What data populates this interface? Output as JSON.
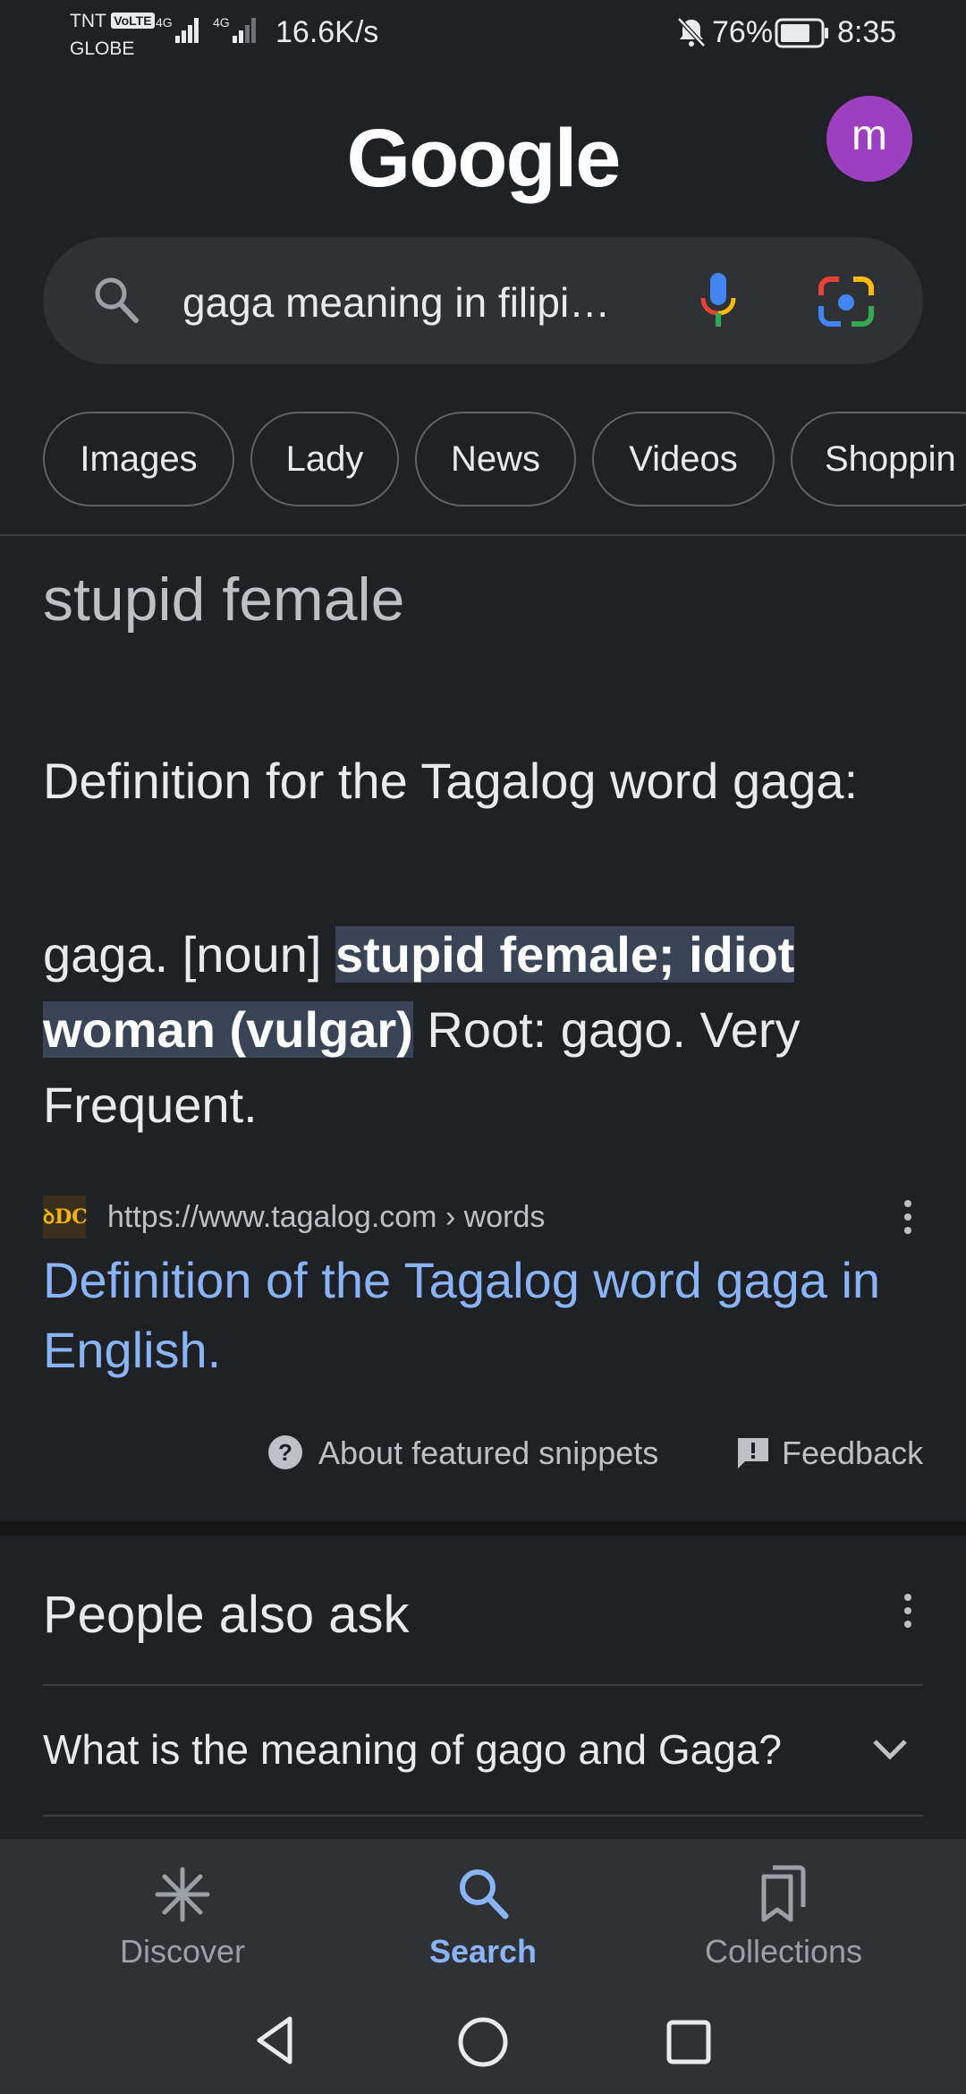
{
  "status_bar": {
    "carrier_line1": "TNT",
    "volte_badge": "VoLTE",
    "carrier_line2": "GLOBE",
    "network_type_1": "4G",
    "network_type_2": "4G",
    "net_speed": "16.6K/s",
    "battery": "76%",
    "battery_level": 0.76,
    "time": "8:35"
  },
  "header": {
    "logo": "Google",
    "avatar_letter": "m",
    "avatar_color": "#9c3fc0"
  },
  "search": {
    "query": "gaga meaning in filipi…"
  },
  "chips": [
    "Images",
    "Lady",
    "News",
    "Videos",
    "Shoppin"
  ],
  "snippet": {
    "answer": "stupid female",
    "definition_title": "Definition for the Tagalog word gaga:",
    "def_prefix": "gaga. [noun] ",
    "def_highlight": "stupid female; idiot woman (vulgar)",
    "def_suffix": " Root: gago. Very Frequent.",
    "favicon_text": "ꝺDC",
    "source_url": "https://www.tagalog.com › words",
    "result_title": "Definition of the Tagalog word gaga in English.",
    "about_label": "About featured snippets",
    "feedback_label": "Feedback"
  },
  "people_also_ask": {
    "title": "People also ask",
    "questions": [
      "What is the meaning of gago and Gaga?"
    ]
  },
  "bottom_nav": {
    "discover": "Discover",
    "search": "Search",
    "collections": "Collections",
    "active_color": "#8ab4f8",
    "inactive_color": "#9aa0a6"
  }
}
